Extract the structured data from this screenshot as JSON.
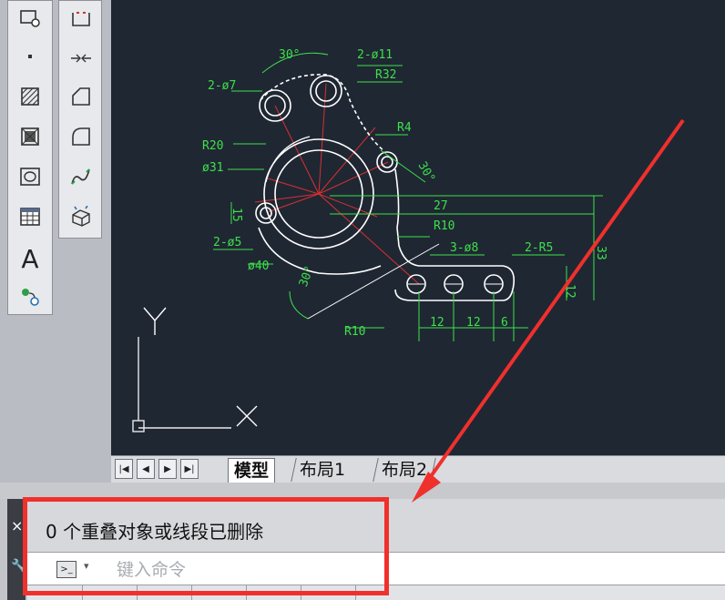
{
  "window": {
    "theme": {
      "canvas_bg": "#1f2733",
      "cad_line": "#ffffff",
      "dim_color": "#3ee04a",
      "construction_red": "#d83030",
      "highlight_red": "#f0302c"
    }
  },
  "toolbar_left": {
    "items": [
      {
        "icon": "block-insert-icon"
      },
      {
        "icon": "point-icon"
      },
      {
        "icon": "hatch-icon"
      },
      {
        "icon": "gradient-icon"
      },
      {
        "icon": "region-icon"
      },
      {
        "icon": "table-icon"
      },
      {
        "icon": "multiline-text-icon",
        "glyph": "A"
      },
      {
        "icon": "add-selected-icon"
      }
    ]
  },
  "toolbar_right": {
    "items": [
      {
        "icon": "break-at-point-icon"
      },
      {
        "icon": "join-icon"
      },
      {
        "icon": "chamfer-icon"
      },
      {
        "icon": "fillet-icon"
      },
      {
        "icon": "blend-curves-icon"
      },
      {
        "icon": "explode-icon"
      }
    ]
  },
  "drawing": {
    "labels": {
      "angle30": "30°",
      "holes2_11": "2-ø11",
      "r32": "R32",
      "holes2_7": "2-ø7",
      "r4": "R4",
      "r20": "R20",
      "dia31": "ø31",
      "angle30b": "30°",
      "fifteen": "15",
      "dim27": "27",
      "r10a": "R10",
      "holes2_5": "2-ø5",
      "holes3_8": "3-ø8",
      "r5": "2-R5",
      "dim33": "33",
      "dia40": "ø40",
      "angle30c": "30°",
      "twelve_v": "12",
      "r10b": "R10",
      "twelve1": "12",
      "twelve2": "12",
      "six": "6"
    },
    "ucs": {
      "y_label": "Y",
      "x_label": "X"
    }
  },
  "layout_tabs": {
    "tabs": [
      {
        "label": "模型",
        "active": true
      },
      {
        "label": "布局1",
        "active": false
      },
      {
        "label": "布局2",
        "active": false
      }
    ]
  },
  "command_line": {
    "handle_close": "×",
    "handle_wrench": "🔧",
    "history": "0 个重叠对象或线段已删除",
    "prompt_icon": ">_",
    "prompt_caret": "▾",
    "input_placeholder": "键入命令"
  }
}
